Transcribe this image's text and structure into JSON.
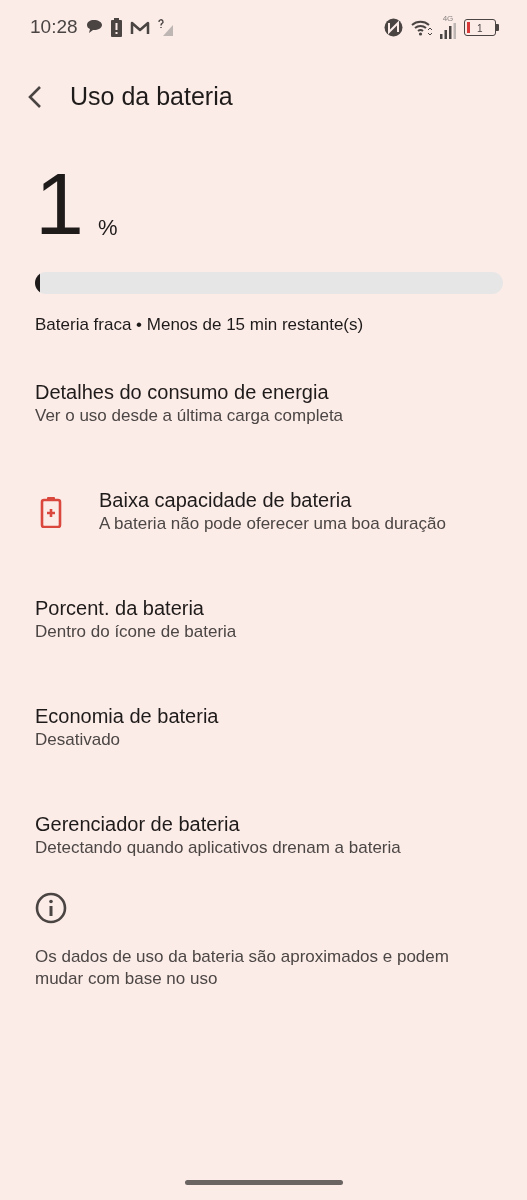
{
  "status_bar": {
    "time": "10:28",
    "network_type": "4G",
    "battery_text": "1"
  },
  "header": {
    "title": "Uso da bateria"
  },
  "battery": {
    "percent": "1",
    "unit": "%",
    "level": 0.01,
    "status": "Bateria fraca • Menos de 15 min restante(s)"
  },
  "settings": [
    {
      "kind": "plain",
      "title": "Detalhes do consumo de energia",
      "subtitle": "Ver o uso desde a última carga completa"
    },
    {
      "kind": "warning",
      "title": "Baixa capacidade de bateria",
      "subtitle": "A bateria não pode oferecer uma boa duração"
    },
    {
      "kind": "plain",
      "title": "Porcent. da bateria",
      "subtitle": "Dentro do ícone de bateria"
    },
    {
      "kind": "plain",
      "title": "Economia de bateria",
      "subtitle": "Desativado"
    },
    {
      "kind": "plain",
      "title": "Gerenciador de bateria",
      "subtitle": "Detectando quando aplicativos drenam a bateria"
    }
  ],
  "footer": {
    "note": "Os dados de uso da bateria são aproximados e podem mudar com base no uso"
  }
}
